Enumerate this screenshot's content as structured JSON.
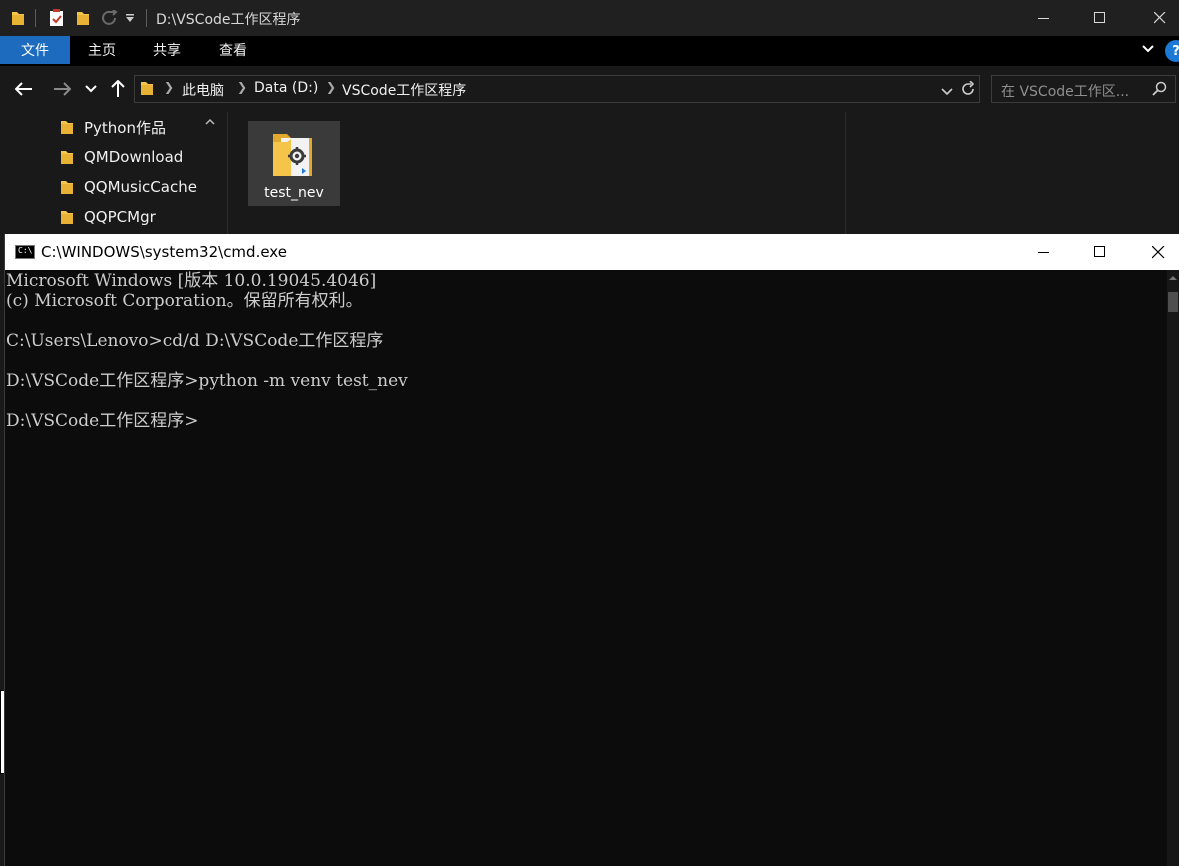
{
  "explorer": {
    "title": "D:\\VSCode工作区程序",
    "ribbon_tabs": [
      "文件",
      "主页",
      "共享",
      "查看"
    ],
    "help_label": "?",
    "breadcrumb": [
      "此电脑",
      "Data (D:)",
      "VSCode工作区程序"
    ],
    "search_placeholder": "在 VSCode工作区...",
    "nav_items": [
      "Python作品",
      "QMDownload",
      "QQMusicCache",
      "QQPCMgr"
    ],
    "files": [
      {
        "name": "test_nev",
        "icon": "settings-folder-icon"
      }
    ]
  },
  "cmd": {
    "title": "C:\\WINDOWS\\system32\\cmd.exe",
    "icon_text": "C:\\",
    "lines": [
      "Microsoft Windows [版本 10.0.19045.4046]",
      "(c) Microsoft Corporation。保留所有权利。",
      "",
      "C:\\Users\\Lenovo>cd/d D:\\VSCode工作区程序",
      "",
      "D:\\VSCode工作区程序>python -m venv test_nev",
      "",
      "D:\\VSCode工作区程序>"
    ]
  },
  "colors": {
    "explorer_bg": "#191919",
    "ribbon_file_tab": "#1c6bbf",
    "folder_yellow": "#f4c54a",
    "console_bg": "#0c0c0c",
    "console_text": "#cccccc"
  }
}
